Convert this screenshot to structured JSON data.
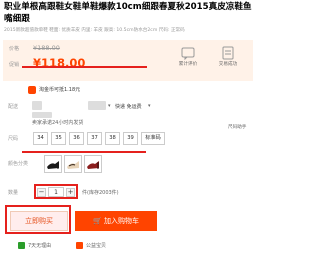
{
  "product": {
    "title": "职业单根高跟鞋女鞋单鞋爆款10cm细跟春夏秋2015真皮凉鞋鱼嘴细跟",
    "subtitle": "2015新款超值款单鞋  鞋面: 优质羊皮  内里: 羊皮 跟高: 10.5cm防水台2cm 尺码: 正常码"
  },
  "price": {
    "orig_label": "价格",
    "orig_value": "¥188.00",
    "promo_label": "促销",
    "promo_value": "¥118.00"
  },
  "stats": {
    "reviews_label": "累计评价",
    "trade_label": "交易成功"
  },
  "tmall": {
    "text": "淘金币可抵1.18元"
  },
  "shipping": {
    "label": "配送",
    "express": "快递 免运费",
    "note": "卖家承诺24小时内发货"
  },
  "size": {
    "label": "尺码",
    "help": "尺码助手",
    "options": [
      "34",
      "35",
      "36",
      "37",
      "38",
      "39",
      "标准码"
    ]
  },
  "color": {
    "label": "颜色分类"
  },
  "quantity": {
    "label": "数量",
    "value": "1",
    "minus": "−",
    "plus": "+",
    "stock": "件(库存2003件)"
  },
  "actions": {
    "buy_now": "立即购买",
    "add_cart": "加入购物车"
  },
  "footer": {
    "return": "7天无理由",
    "pay": "公益宝贝"
  },
  "colors": {
    "accent": "#f40",
    "red_mark": "#e5211d",
    "price_bg": "#fff2e8"
  }
}
